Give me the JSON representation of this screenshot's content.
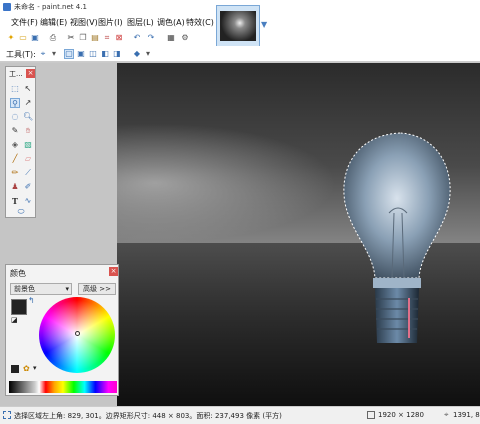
{
  "window": {
    "title": "未命名 - paint.net 4.1"
  },
  "menu": [
    {
      "label": "文件(F)"
    },
    {
      "label": "编辑(E)"
    },
    {
      "label": "视图(V)"
    },
    {
      "label": "图片(I)"
    },
    {
      "label": "图层(L)"
    },
    {
      "label": "调色(A)"
    },
    {
      "label": "特效(C)"
    }
  ],
  "toolbar2": {
    "tool_label": "工具(T):"
  },
  "tools_panel": {
    "title": "工..."
  },
  "colors_panel": {
    "title": "颜色",
    "mode": "前景色",
    "more_button": "高级 >>"
  },
  "status": {
    "selection": "选择区域左上角:  829,  301。边界矩形尺寸: 448 × 803。面积: 237,493 像素 (平方)",
    "image_size": "1920 × 1280",
    "coords": "1391, 8..."
  }
}
